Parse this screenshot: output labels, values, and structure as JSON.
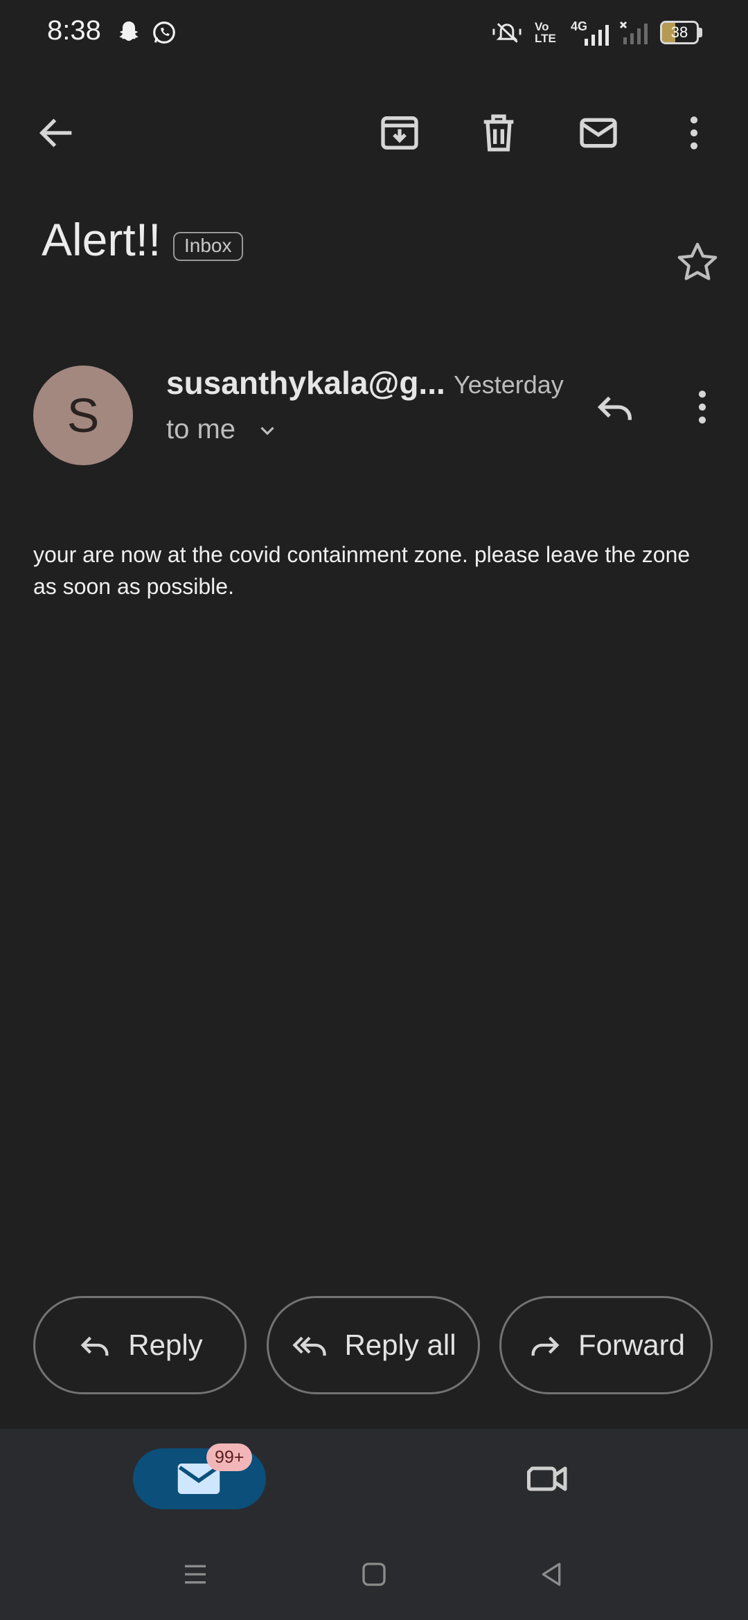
{
  "status_bar": {
    "time": "8:38",
    "battery_percent": 38,
    "battery_label": "38",
    "network_label": "4G",
    "icons": [
      "snapchat-icon",
      "whatsapp-icon",
      "mute-icon",
      "volte-icon",
      "signal-icon",
      "signal-icon",
      "battery-icon"
    ]
  },
  "toolbar": {
    "icons": [
      "back-arrow-icon",
      "archive-icon",
      "trash-icon",
      "mark-unread-icon",
      "more-vert-icon"
    ]
  },
  "email": {
    "subject": "Alert!!",
    "label": "Inbox",
    "starred": false,
    "sender_initial": "S",
    "sender": "susanthykala@g...",
    "time": "Yesterday",
    "recipient": "to me",
    "body": "your are now at the covid containment zone. please leave the zone as soon as possible."
  },
  "actions": {
    "reply": "Reply",
    "reply_all": "Reply all",
    "forward": "Forward"
  },
  "bottom_nav": {
    "mail_badge": "99+",
    "items": [
      "mail-icon",
      "video-icon"
    ]
  },
  "colors": {
    "background": "#202020",
    "avatar": "#a38880",
    "active_nav": "#0b4f7a",
    "badge": "#f2b6b8"
  }
}
